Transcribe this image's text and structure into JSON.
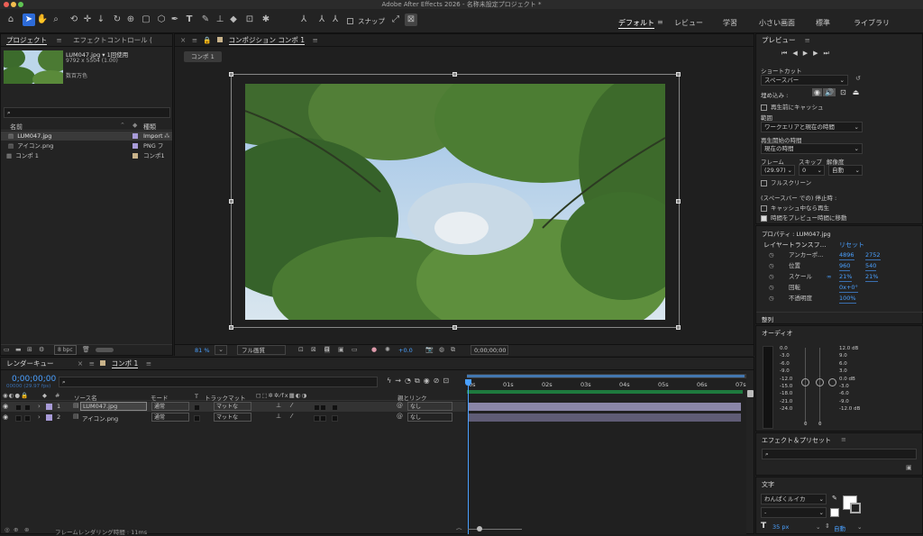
{
  "app": {
    "title": "Adobe After Effects 2026 - 名称未設定プロジェクト *"
  },
  "colors": {
    "accent": "#2d6bd8",
    "selection": "#4aa0ff",
    "timecode": "#4aa0ff",
    "work_area_bar": "#4aa0ff"
  },
  "toolbar": {
    "snap_label": "スナップ",
    "workspaces": [
      "デフォルト",
      "レビュー",
      "学習",
      "小さい画面",
      "標準",
      "ライブラリ"
    ],
    "icons": [
      "home-icon",
      "selection-tool-icon",
      "hand-tool-icon",
      "zoom-tool-icon",
      "orbit-camera-icon",
      "pan-camera-icon",
      "dolly-camera-icon",
      "rotate-tool-icon",
      "anchor-point-tool-icon",
      "shape-tool-icon",
      "pen-tool-icon",
      "type-tool-icon",
      "brush-tool-icon",
      "clone-stamp-icon",
      "eraser-icon",
      "roto-brush-icon",
      "puppet-pin-icon"
    ]
  },
  "project": {
    "tab_label": "プロジェクト",
    "effects_tab_label": "エフェクトコントロール (",
    "selected_name": "LUM047.jpg ▾ 1回使用",
    "selected_dims": "9792 x 5504 (1.00)",
    "selected_colors": "数百万色",
    "col_name": "名前",
    "col_type": "種類",
    "items": [
      {
        "name": "LUM047.jpg",
        "type": "Import",
        "selected": true
      },
      {
        "name": "アイコン.png",
        "type": "PNG フ",
        "selected": false
      },
      {
        "name": "コンポ 1",
        "type": "コンポ1",
        "selected": false
      }
    ],
    "bpc_label": "8 bpc"
  },
  "composition": {
    "tab_label": "コンポジション コンポ 1",
    "breadcrumb": "コンポ 1",
    "zoom": "81 %",
    "quality": "フル画質",
    "exposure": "+0.0",
    "timecode": "0;00;00;00"
  },
  "preview": {
    "title": "プレビュー",
    "shortcut_label": "ショートカット",
    "shortcut_value": "スペースバー",
    "embed_label": "埋め込み :",
    "cache_before": "再生前にキャッシュ",
    "range_label": "範囲",
    "range_value": "ワークエリアと現在の時間",
    "start_label": "再生開始の時間",
    "start_value": "現在の時間",
    "frame_label": "フレーム",
    "skip_label": "スキップ",
    "res_label": "解像度",
    "frame_value": "(29.97)",
    "skip_value": "0",
    "res_value": "自動",
    "fullscreen": "フルスクリーン",
    "stop_label": "(スペースバー での) 停止時 :",
    "stop_opt1": "キャッシュ中なら再生",
    "stop_opt2": "時間をプレビュー時間に移動"
  },
  "properties": {
    "title": "プロパティ : LUM047.jpg",
    "section": "レイヤートランスフ…",
    "reset": "リセット",
    "rows": [
      {
        "name": "アンカーポ…",
        "v1": "4896",
        "v2": "2752"
      },
      {
        "name": "位置",
        "v1": "960",
        "v2": "540"
      },
      {
        "name": "スケール",
        "v1": "21%",
        "v2": "21%"
      },
      {
        "name": "回転",
        "v1": "0x+0°",
        "v2": ""
      },
      {
        "name": "不透明度",
        "v1": "100%",
        "v2": ""
      }
    ]
  },
  "align": {
    "title": "整列"
  },
  "audio": {
    "title": "オーディオ",
    "left_scale": [
      "0.0",
      "-3.0",
      "-6.0",
      "-9.0",
      "-12.0",
      "-15.0",
      "-18.0",
      "-21.0",
      "-24.0"
    ],
    "right_scale": [
      "12.0 dB",
      "9.0",
      "6.0",
      "3.0",
      "0.0 dB",
      "-3.0",
      "-6.0",
      "-9.0",
      "-12.0 dB"
    ],
    "zero_left": "0",
    "zero_right": "0"
  },
  "effects": {
    "title": "エフェクト＆プリセット"
  },
  "character": {
    "title": "文字",
    "font": "わんぱくルイカ",
    "style": "-",
    "size": "35 px",
    "leading": "自動"
  },
  "timeline": {
    "render_tab": "レンダーキュー",
    "comp_tab": "コンポ 1",
    "timecode": "0;00;00;00",
    "fps": "00000 (29.97 fps)",
    "col_source": "ソース名",
    "col_mode": "モード",
    "col_t": "T",
    "col_matte": "トラックマット",
    "col_parent": "親とリンク",
    "layers": [
      {
        "num": "1",
        "name": "LUM047.jpg",
        "mode": "通常",
        "matte": "マットな",
        "parent": "なし"
      },
      {
        "num": "2",
        "name": "アイコン.png",
        "mode": "通常",
        "matte": "マットな",
        "parent": "なし"
      }
    ],
    "ruler": [
      "0s",
      "01s",
      "02s",
      "03s",
      "04s",
      "05s",
      "06s",
      "07s"
    ],
    "render_time": "フレームレンダリング時間 : 11ms"
  }
}
